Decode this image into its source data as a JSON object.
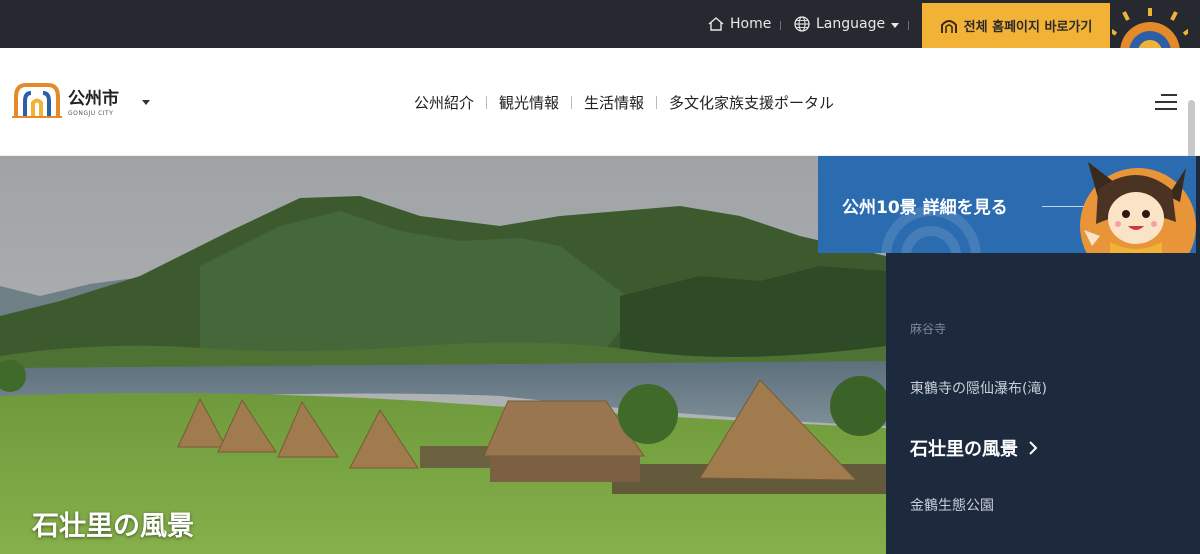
{
  "topbar": {
    "home_label": "Home",
    "home_icon": "home-icon",
    "language_label": "Language",
    "language_icon": "globe-icon",
    "full_site_label": "전체 홈페이지 바로가기",
    "full_site_icon": "gate-icon",
    "bg_color": "#262a30",
    "accent_color": "#f2b236"
  },
  "header": {
    "logo_name": "公州市",
    "logo_sub": "GONGJU CITY",
    "nav": [
      "公州紹介",
      "観光情報",
      "生活情報",
      "多文化家族支援ポータル"
    ],
    "menu_icon": "hamburger-icon"
  },
  "hero": {
    "title": "石壮里の風景"
  },
  "promo": {
    "label": "公州10景 詳細を見る",
    "color": "#2b6bb0"
  },
  "side": {
    "items": [
      "麻谷寺",
      "東鶴寺の隠仙瀑布(滝)",
      "石壮里の風景",
      "金鶴生態公園"
    ],
    "active_index": 2,
    "bg_color": "#1d2a3e"
  }
}
